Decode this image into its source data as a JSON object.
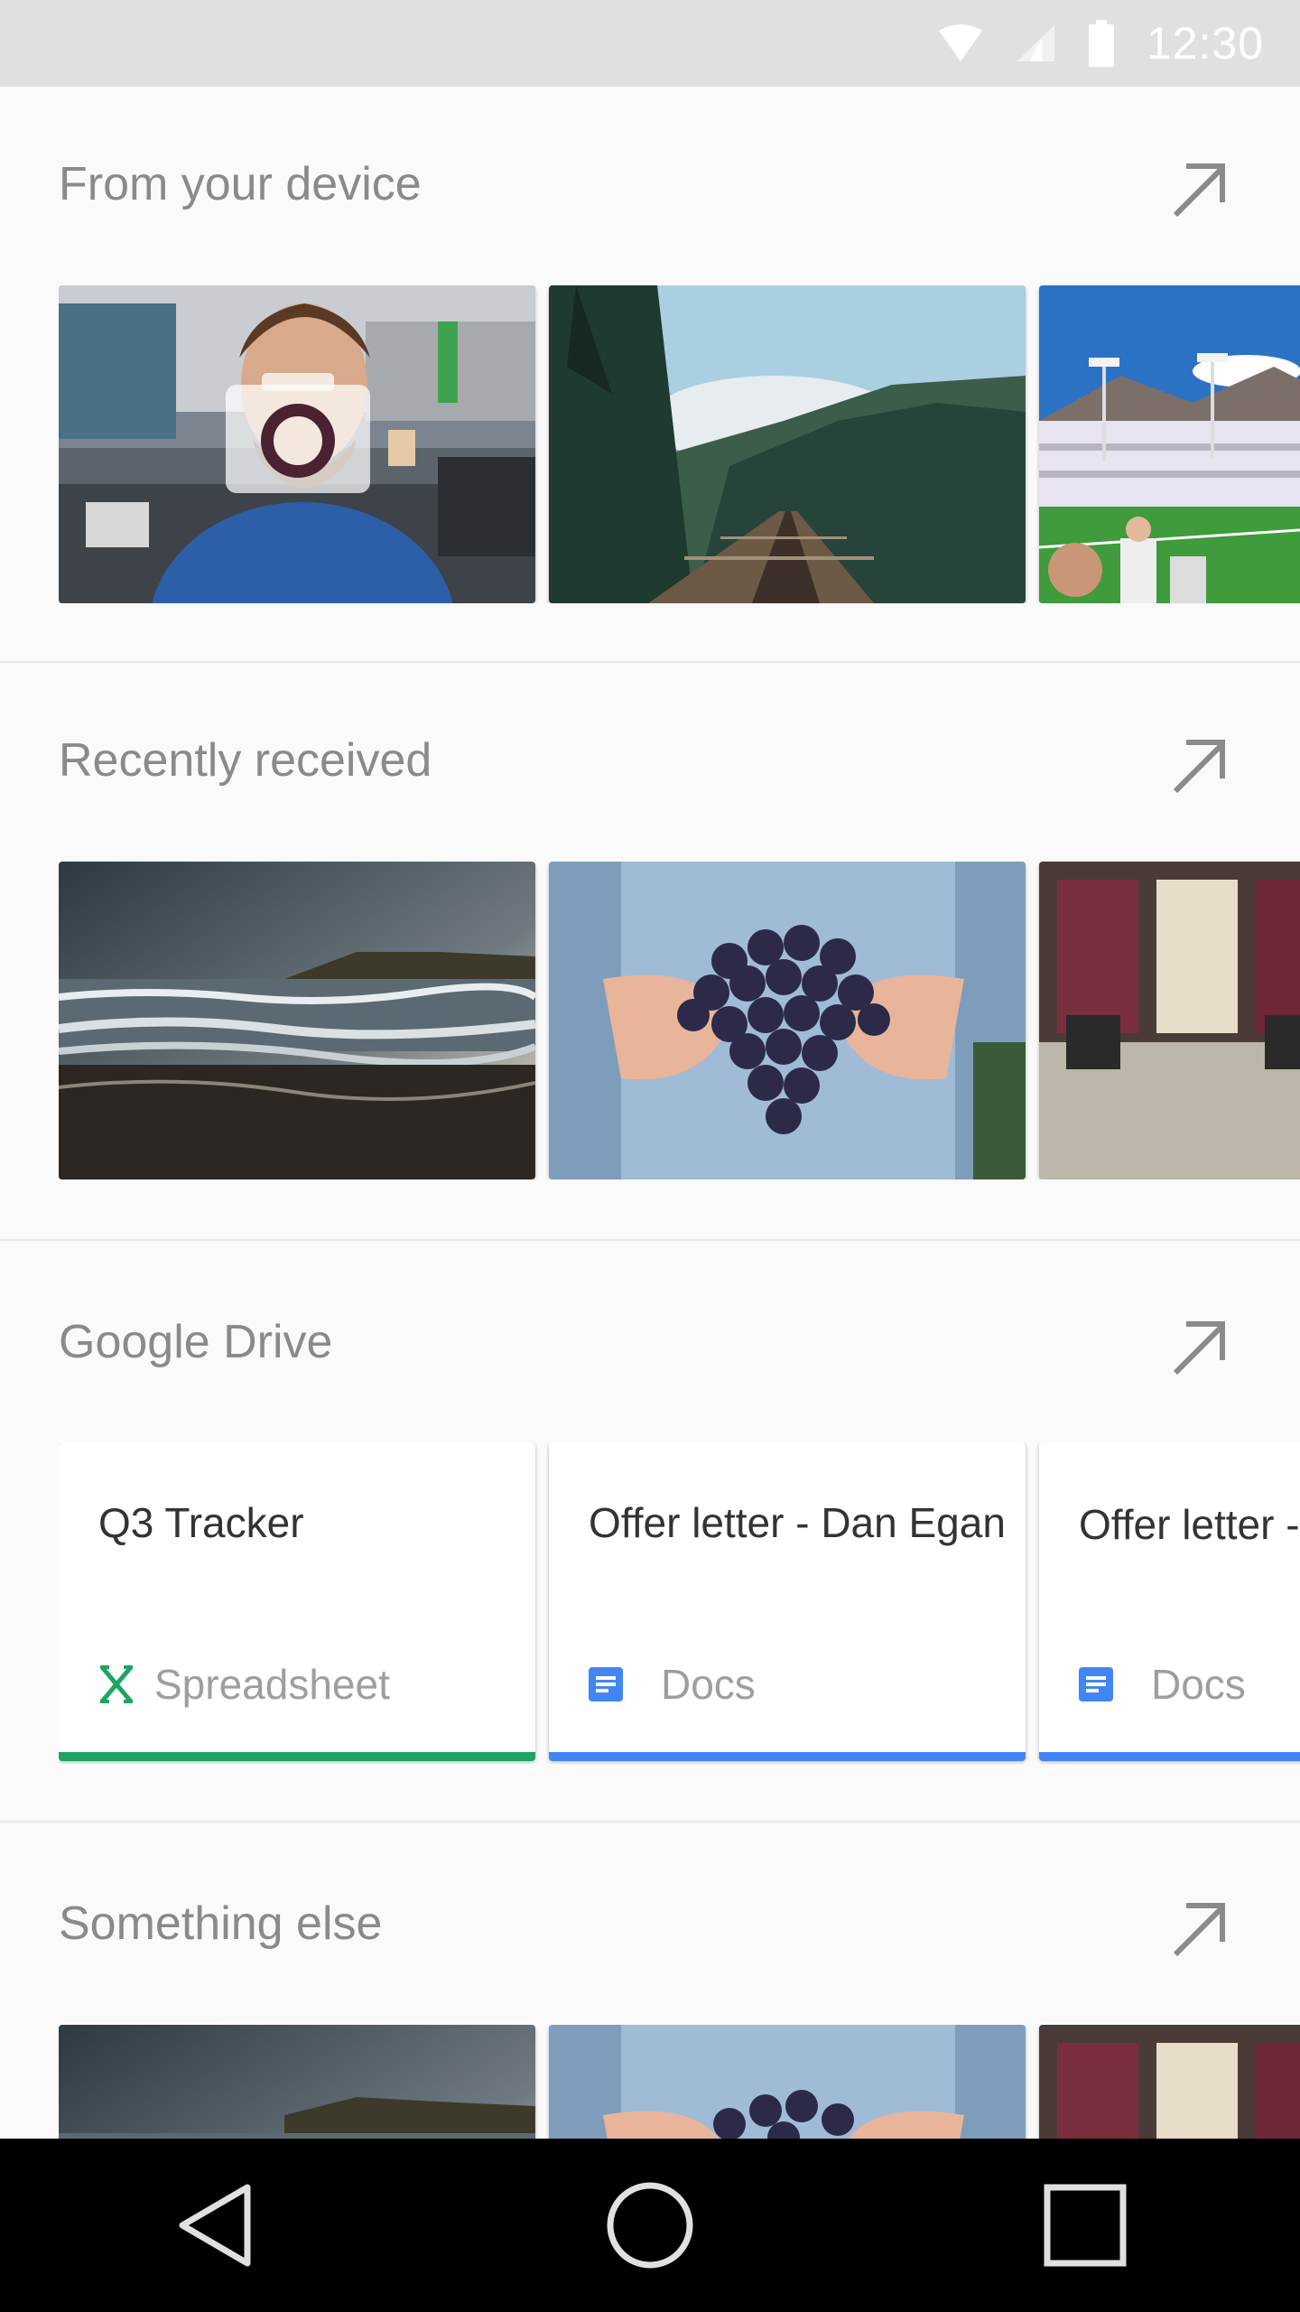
{
  "status_bar": {
    "time": "12:30",
    "icons": [
      "wifi-icon",
      "signal-icon",
      "battery-icon"
    ]
  },
  "sections": [
    {
      "title": "From your device",
      "expand_icon": "arrow-up-right-icon",
      "items": [
        "camera-tile",
        "railroad-forest-photo",
        "stadium-photo"
      ]
    },
    {
      "title": "Recently received",
      "expand_icon": "arrow-up-right-icon",
      "items": [
        "beach-photo",
        "grapes-photo",
        "locker-room-photo"
      ]
    },
    {
      "title": "Google Drive",
      "expand_icon": "arrow-up-right-icon",
      "cards": [
        {
          "title": "Q3 Tracker",
          "type": "Spreadsheet",
          "icon": "sheets-icon",
          "accent": "#1fa463"
        },
        {
          "title": "Offer letter - Dan Egan",
          "type": "Docs",
          "icon": "docs-icon",
          "accent": "#4285f4"
        },
        {
          "title": "Offer letter - Jo Smith",
          "type": "Docs",
          "icon": "docs-icon",
          "accent": "#4285f4"
        }
      ]
    },
    {
      "title": "Something else",
      "expand_icon": "arrow-up-right-icon",
      "items": [
        "beach-photo",
        "grapes-photo",
        "locker-room-photo"
      ]
    }
  ],
  "nav_bar": {
    "buttons": [
      "back-icon",
      "home-icon",
      "recents-icon"
    ]
  },
  "colors": {
    "status_bar": "#e0e0e0",
    "background": "#fafafa",
    "sheets_green": "#1fa463",
    "docs_blue": "#4285f4"
  }
}
